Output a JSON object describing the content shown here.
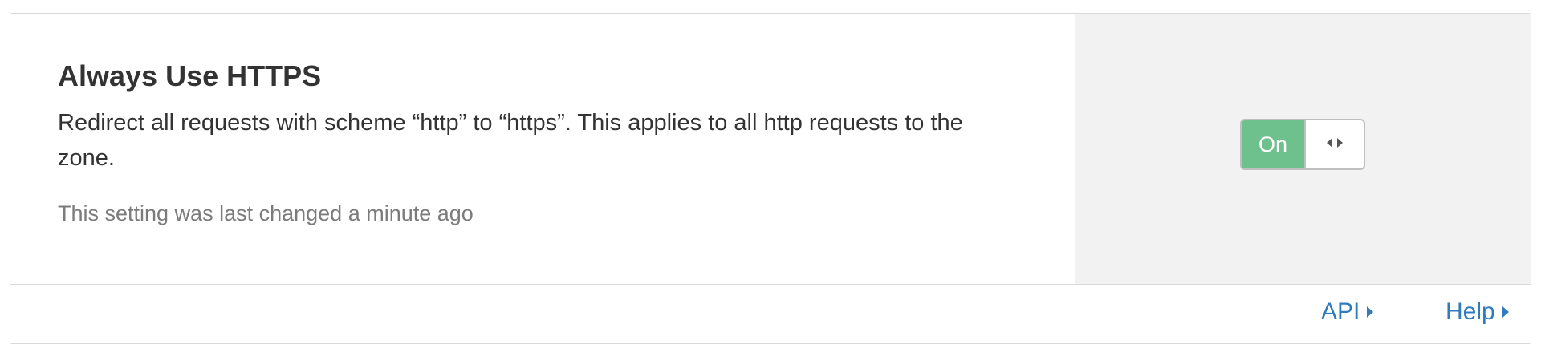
{
  "setting": {
    "title": "Always Use HTTPS",
    "description": "Redirect all requests with scheme “http” to “https”. This applies to all http requests to the zone.",
    "last_changed": "This setting was last changed a minute ago"
  },
  "toggle": {
    "state_label": "On",
    "on_color": "#6ec18d",
    "handle_icon": "left-right-arrows-icon"
  },
  "footer": {
    "links": [
      {
        "label": "API",
        "icon": "caret-right-icon",
        "color": "#2f7bbf"
      },
      {
        "label": "Help",
        "icon": "caret-right-icon",
        "color": "#2f7bbf"
      }
    ]
  }
}
